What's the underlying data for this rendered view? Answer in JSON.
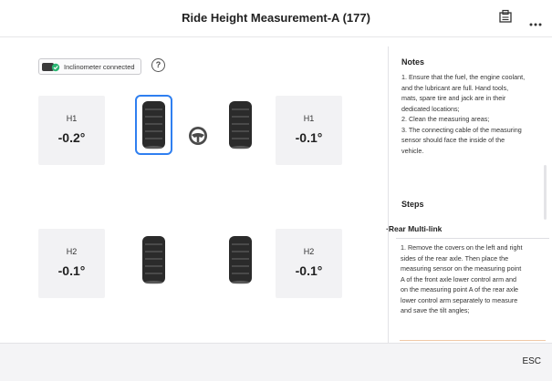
{
  "header": {
    "title": "Ride Height Measurement-A (177)",
    "icons": [
      "report-icon",
      "more-icon"
    ]
  },
  "status": {
    "text": "Inclinometer connected",
    "icon": "inclinometer-plug-icon"
  },
  "help_icon": "?",
  "measurements": [
    {
      "label": "H1",
      "value": "-0.2°"
    },
    {
      "label": "H1",
      "value": "-0.1°"
    },
    {
      "label": "H2",
      "value": "-0.1°"
    },
    {
      "label": "H2",
      "value": "-0.1°"
    }
  ],
  "notes": {
    "title": "Notes",
    "lines": [
      "1. Ensure that the fuel, the engine coolant,",
      "and the lubricant are full. Hand tools,",
      "mats, spare tire and jack are in their",
      "dedicated locations;",
      "2. Clean the measuring areas;",
      "3. The connecting cable of the measuring",
      "sensor should face the inside of the",
      "vehicle."
    ]
  },
  "steps": {
    "title": "Steps",
    "sub_title": "·Rear Multi-link",
    "lines": [
      "1. Remove the covers on the left and right",
      "sides of the rear axle. Then place the",
      "measuring sensor on the measuring point",
      "A of the front axle lower control arm and",
      "on the measuring point A of the rear axle",
      "lower control arm separately to measure",
      "and save the tilt angles;"
    ]
  },
  "footer": {
    "esc_label": "ESC"
  },
  "colors": {
    "accent": "#2f7ff0",
    "status_green": "#2bb673"
  }
}
